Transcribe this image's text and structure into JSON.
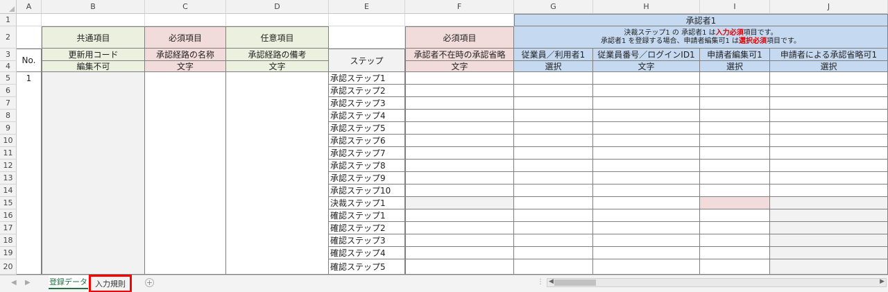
{
  "columns": [
    "A",
    "B",
    "C",
    "D",
    "E",
    "F",
    "G",
    "H",
    "I",
    "J"
  ],
  "rows": [
    "1",
    "2",
    "3",
    "4",
    "5",
    "6",
    "7",
    "8",
    "9",
    "10",
    "11",
    "12",
    "13",
    "14",
    "15",
    "16",
    "17",
    "18",
    "19",
    "20"
  ],
  "header": {
    "approver_group": "承認者1",
    "common": "共通項目",
    "required_c": "必須項目",
    "optional_d": "任意項目",
    "required_f": "必須項目",
    "note_line1_a": "決裁ステップ1 の 承認者1 は",
    "note_line1_b": "入力必須",
    "note_line1_c": "項目です。",
    "note_line2_a": "承認者1 を登録する場合、申請者編集可1 は",
    "note_line2_b": "選択必須",
    "note_line2_c": "項目です。",
    "no": "No.",
    "step": "ステップ",
    "b3": "更新用コード",
    "c3": "承認経路の名称",
    "d3": "承認経路の備考",
    "f3": "承認者不在時の承認省略",
    "g3": "従業員／利用者1",
    "h3": "従業員番号／ログインID1",
    "i3": "申請者編集可1",
    "j3": "申請者による承認省略可1",
    "b4": "編集不可",
    "c4": "文字",
    "d4": "文字",
    "f4": "文字",
    "g4": "選択",
    "h4": "文字",
    "i4": "選択",
    "j4": "選択"
  },
  "data": {
    "no_value": "1",
    "steps": [
      "承認ステップ1",
      "承認ステップ2",
      "承認ステップ3",
      "承認ステップ4",
      "承認ステップ5",
      "承認ステップ6",
      "承認ステップ7",
      "承認ステップ8",
      "承認ステップ9",
      "承認ステップ10",
      "決裁ステップ1",
      "確認ステップ1",
      "確認ステップ2",
      "確認ステップ3",
      "確認ステップ4",
      "確認ステップ5"
    ]
  },
  "sheets": {
    "active": "登録データ",
    "rules": "入力規則"
  },
  "colors": {
    "green": "#ebf1de",
    "pink": "#f2dcdb",
    "blue": "#c5d9f1",
    "highlight": "#ff0000",
    "excel_green": "#217346"
  }
}
